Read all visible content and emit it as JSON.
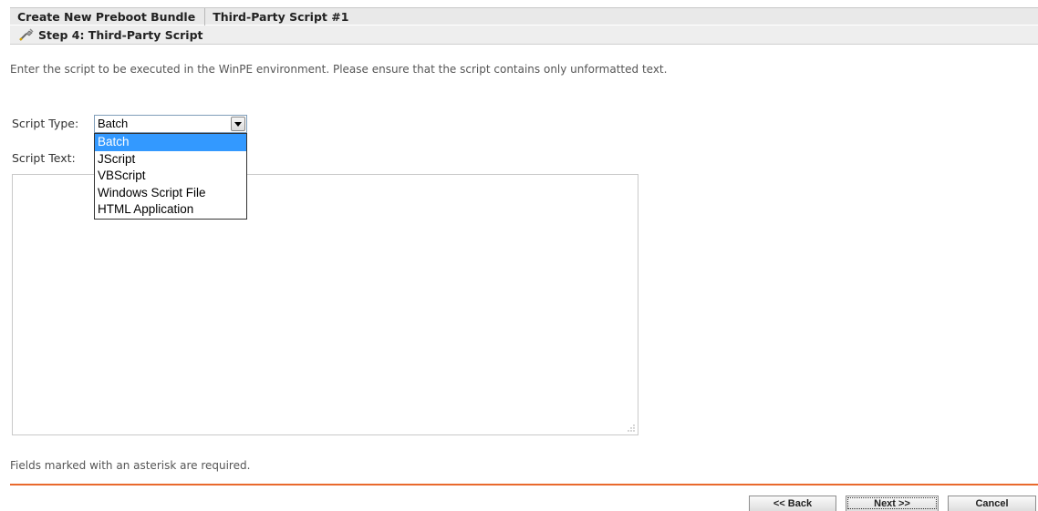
{
  "header": {
    "breadcrumb_main": "Create New Preboot Bundle",
    "breadcrumb_current": "Third-Party Script #1"
  },
  "step": {
    "title": "Step 4: Third-Party Script",
    "icon": "wrench-icon"
  },
  "intro_text": "Enter the script to be executed in the WinPE environment. Please ensure that the script contains only unformatted text.",
  "form": {
    "script_type_label": "Script Type:",
    "script_type_value": "Batch",
    "script_type_options": [
      "Batch",
      "JScript",
      "VBScript",
      "Windows Script File",
      "HTML Application"
    ],
    "script_text_label": "Script Text:",
    "script_text_value": ""
  },
  "footer": {
    "required_note": "Fields marked with an asterisk are required.",
    "back_label": "<< Back",
    "next_label": "Next >>",
    "cancel_label": "Cancel"
  },
  "colors": {
    "accent_rule": "#e9692c",
    "selection": "#3399ff"
  }
}
